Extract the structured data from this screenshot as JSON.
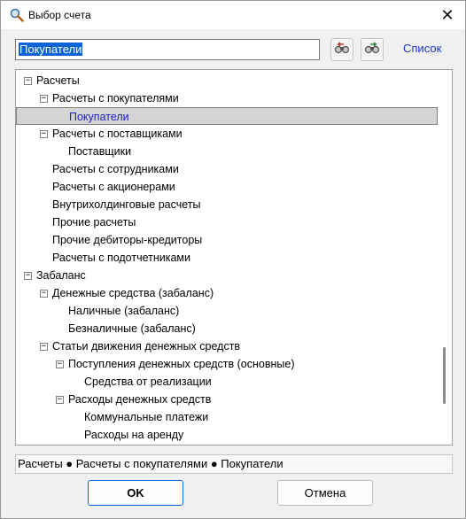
{
  "window": {
    "title": "Выбор счета",
    "close_glyph": "✕"
  },
  "search": {
    "value": "Покупатели"
  },
  "toolbar": {
    "list_label": "Список"
  },
  "tree": {
    "items": [
      {
        "label": "Расчеты",
        "level": 0,
        "toggle": "−",
        "selected": false
      },
      {
        "label": "Расчеты с покупателями",
        "level": 1,
        "toggle": "−",
        "selected": false
      },
      {
        "label": "Покупатели",
        "level": 2,
        "toggle": "",
        "selected": true
      },
      {
        "label": "Расчеты с поставщиками",
        "level": 1,
        "toggle": "−",
        "selected": false
      },
      {
        "label": "Поставщики",
        "level": 2,
        "toggle": "",
        "selected": false
      },
      {
        "label": "Расчеты с сотрудниками",
        "level": 1,
        "toggle": "",
        "selected": false
      },
      {
        "label": "Расчеты с акционерами",
        "level": 1,
        "toggle": "",
        "selected": false
      },
      {
        "label": "Внутрихолдинговые расчеты",
        "level": 1,
        "toggle": "",
        "selected": false
      },
      {
        "label": "Прочие расчеты",
        "level": 1,
        "toggle": "",
        "selected": false
      },
      {
        "label": "Прочие дебиторы-кредиторы",
        "level": 1,
        "toggle": "",
        "selected": false
      },
      {
        "label": "Расчеты с подотчетниками",
        "level": 1,
        "toggle": "",
        "selected": false
      },
      {
        "label": "Забаланс",
        "level": 0,
        "toggle": "−",
        "selected": false
      },
      {
        "label": "Денежные средства (забаланс)",
        "level": 1,
        "toggle": "−",
        "selected": false
      },
      {
        "label": "Наличные (забаланс)",
        "level": 2,
        "toggle": "",
        "selected": false
      },
      {
        "label": "Безналичные (забаланс)",
        "level": 2,
        "toggle": "",
        "selected": false
      },
      {
        "label": "Статьи движения денежных средств",
        "level": 1,
        "toggle": "−",
        "selected": false
      },
      {
        "label": "Поступления денежных средств (основные)",
        "level": 2,
        "toggle": "−",
        "selected": false
      },
      {
        "label": "Средства от реализации",
        "level": 3,
        "toggle": "",
        "selected": false
      },
      {
        "label": "Расходы денежных средств",
        "level": 2,
        "toggle": "−",
        "selected": false
      },
      {
        "label": "Коммунальные платежи",
        "level": 3,
        "toggle": "",
        "selected": false
      },
      {
        "label": "Расходы на аренду",
        "level": 3,
        "toggle": "",
        "selected": false
      }
    ]
  },
  "status": {
    "path": "Расчеты ● Расчеты с покупателями ● Покупатели"
  },
  "buttons": {
    "ok": "OK",
    "cancel": "Отмена"
  },
  "colors": {
    "selection": "#0a64d8",
    "link": "#1a35c9",
    "selected_item_text": "#2020c8"
  }
}
